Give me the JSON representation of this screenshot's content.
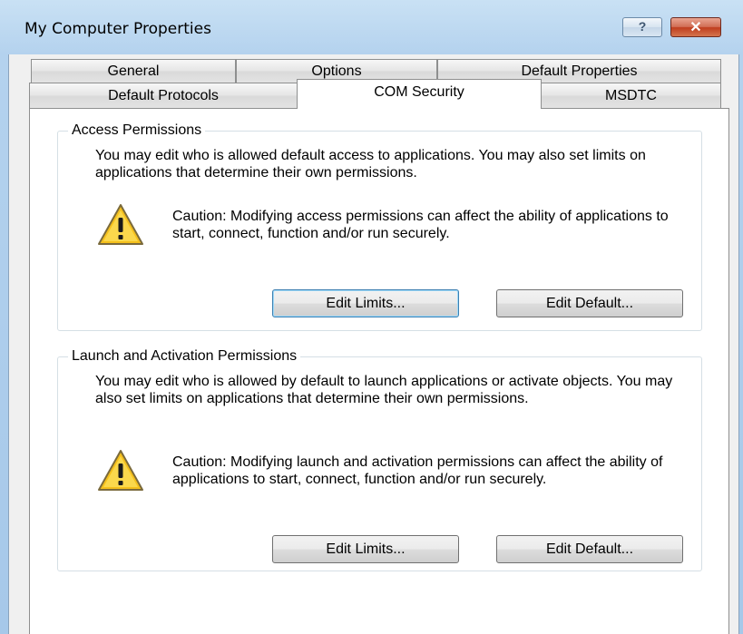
{
  "window": {
    "title": "My Computer Properties",
    "help_glyph": "?",
    "close_glyph": "✕"
  },
  "tabs": {
    "back_row": [
      "General",
      "Options",
      "Default Properties"
    ],
    "front_row": [
      "Default Protocols",
      "COM Security",
      "MSDTC"
    ],
    "active": "COM Security"
  },
  "access": {
    "legend": "Access Permissions",
    "description": "You may edit who is allowed default access to applications. You may also set limits on applications that determine their own permissions.",
    "caution": "Caution: Modifying access permissions can affect the ability of applications to start, connect, function and/or run securely.",
    "edit_limits_label": "Edit Limits...",
    "edit_default_label": "Edit Default..."
  },
  "launch": {
    "legend": "Launch and Activation Permissions",
    "description": "You may edit who is allowed by default to launch applications or activate objects. You may also set limits on applications that determine their own permissions.",
    "caution": "Caution: Modifying launch and activation permissions can affect the ability of applications to start, connect, function and/or run securely.",
    "edit_limits_label": "Edit Limits...",
    "edit_default_label": "Edit Default..."
  },
  "icons": {
    "help": "help-icon",
    "close": "close-icon",
    "warning": "warning-icon"
  },
  "colors": {
    "title_gradient": "#b4d2ee",
    "close_button": "#c03d1e",
    "warning_yellow": "#f5c01c",
    "default_button_border": "#3c7fb1"
  }
}
